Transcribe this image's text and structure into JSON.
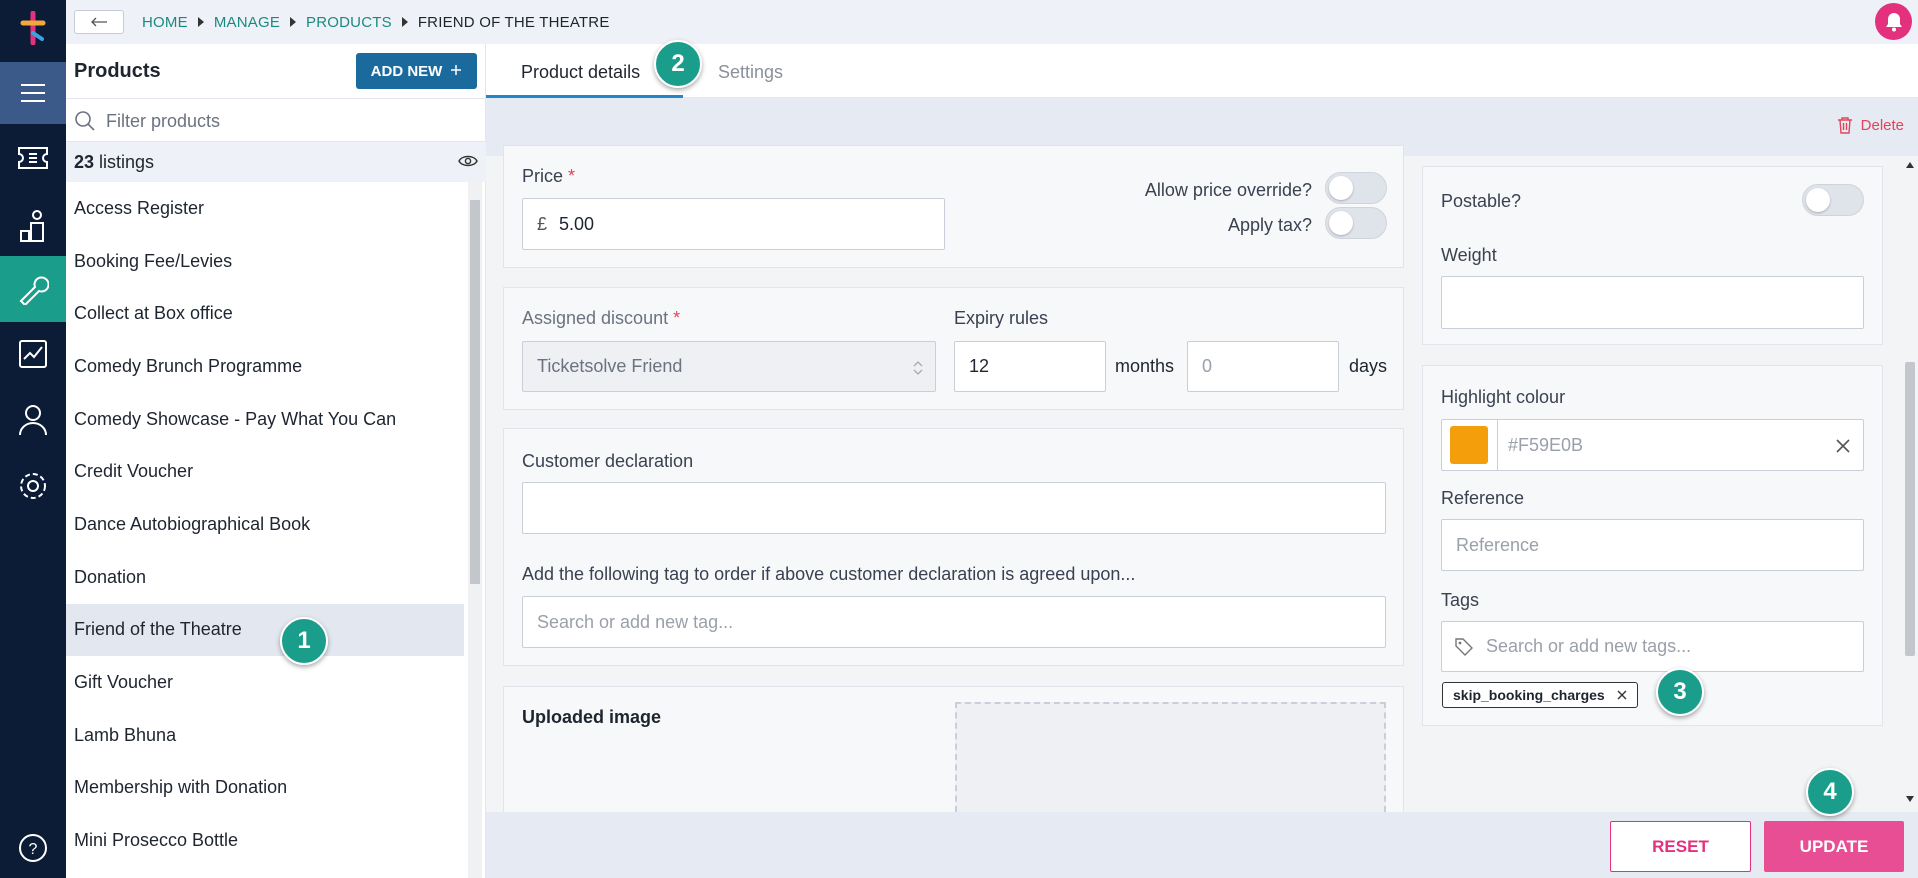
{
  "colors": {
    "brand_pink": "#e3317d",
    "nav_bg": "#0d1c36",
    "accent_teal": "#1a9e8b",
    "add_new": "#1b6a9e",
    "highlight": "#F59E0B"
  },
  "nav": {
    "icons": [
      "logo-icon",
      "menu-icon",
      "ticket-icon",
      "user-stage-icon",
      "wrench-icon",
      "report-icon",
      "person-icon",
      "gear-icon",
      "help-icon"
    ]
  },
  "breadcrumb": {
    "items": [
      "HOME",
      "MANAGE",
      "PRODUCTS"
    ],
    "current": "FRIEND OF THE THEATRE"
  },
  "products": {
    "title": "Products",
    "add_new": "ADD NEW",
    "filter_placeholder": "Filter products",
    "count": "23",
    "count_label": "listings",
    "items": [
      "Access Register",
      "Booking Fee/Levies",
      "Collect at Box office",
      "Comedy Brunch Programme",
      "Comedy Showcase - Pay What You Can",
      "Credit Voucher",
      "Dance Autobiographical Book",
      "Donation",
      "Friend of the Theatre",
      "Gift Voucher",
      "Lamb Bhuna",
      "Membership with Donation",
      "Mini Prosecco Bottle"
    ],
    "selected_index": 8
  },
  "tabs": {
    "details": "Product details",
    "settings": "Settings"
  },
  "actions": {
    "delete": "Delete",
    "reset": "RESET",
    "update": "UPDATE"
  },
  "form": {
    "price_label": "Price",
    "required_mark": "*",
    "currency": "£",
    "price_value": "5.00",
    "allow_override_label": "Allow price override?",
    "apply_tax_label": "Apply tax?",
    "assigned_discount_label": "Assigned discount",
    "assigned_discount_value": "Ticketsolve Friend",
    "expiry_label": "Expiry rules",
    "expiry_months": "12",
    "months_label": "months",
    "expiry_days_placeholder": "0",
    "days_label": "days",
    "customer_declaration_label": "Customer declaration",
    "tag_agree_label": "Add the following tag to order if above customer declaration is agreed upon...",
    "tag_agree_placeholder": "Search or add new tag...",
    "uploaded_image_label": "Uploaded image",
    "postable_label": "Postable?",
    "weight_label": "Weight",
    "highlight_label": "Highlight colour",
    "highlight_value": "#F59E0B",
    "reference_label": "Reference",
    "reference_placeholder": "Reference",
    "tags_label": "Tags",
    "tags_placeholder": "Search or add new tags...",
    "tags": [
      "skip_booking_charges"
    ]
  },
  "badges": [
    "1",
    "2",
    "3",
    "4"
  ]
}
